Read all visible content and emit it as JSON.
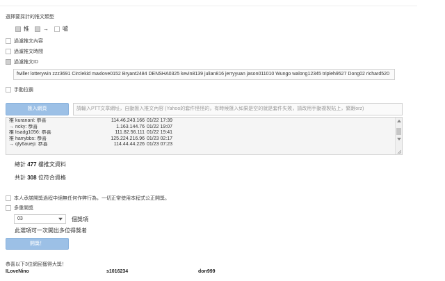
{
  "header": {
    "select_type_label": "選擇要採計的推文類型",
    "push_types": [
      {
        "label": "推",
        "checked": true
      },
      {
        "label": "→",
        "checked": true
      },
      {
        "label": "噓",
        "checked": false
      }
    ]
  },
  "filters": [
    {
      "label": "過濾推文內容",
      "checked": false
    },
    {
      "label": "過濾推文時間",
      "checked": false
    },
    {
      "label": "過濾推文ID",
      "checked": true
    }
  ],
  "id_filter_value": "fwiller lotterywin zzz3691 Circlekid maxlove0152 Bryant2484 DENSHA0325 kevin8139 julian816 jerryyuan jason011010 Wungo walong12345 tripleh9527 Dong02 richard520",
  "manual_pull": {
    "label": "手動拉霸",
    "checked": false
  },
  "import": {
    "button_label": "匯入網頁",
    "url_placeholder": "請輸入PTT文章網址，自動匯入推文內容 (Yahoo的套件怪怪的，有時候匯入如果是空的就是套件失敗，請改用手動複製貼上，緊跟orz)"
  },
  "comments": [
    {
      "name": "推 kurananl: 恭喜",
      "ip": "114.46.243.166",
      "date": "01/22 17:39"
    },
    {
      "name": "→ ncky: 恭喜",
      "ip": "1.163.144.76",
      "date": "01/22 19:07"
    },
    {
      "name": "推 lisadg1056: 恭喜",
      "ip": "111.82.56.111",
      "date": "01/22 19:41"
    },
    {
      "name": "推 harrybbs: 恭喜",
      "ip": "125.224.216.96",
      "date": "01/23 02:17"
    },
    {
      "name": "→ qfy6auep: 恭喜",
      "ip": "114.44.44.226",
      "date": "01/23 07:23"
    }
  ],
  "stats": {
    "total_prefix": "總計",
    "total_count": "477",
    "total_suffix": "樓推文資料",
    "qualified_prefix": "共計",
    "qualified_count": "308",
    "qualified_suffix": "位符合資格"
  },
  "commitment": {
    "label": "本人承諾開獎過程中絕無任何作弊行為，一切正常使用本程式公正開獎。",
    "checked": false
  },
  "multi_draw": {
    "label": "多重開獎",
    "checked": false
  },
  "prize": {
    "selected": "03",
    "suffix": "個獎項",
    "note": "此選項可一次開出多位得獎者"
  },
  "draw_button_label": "開獎！",
  "result": {
    "label": "恭喜以下3位網民獲得大獎！",
    "winners": [
      "ILoveNino",
      "s1016234",
      "don999"
    ]
  },
  "colors": {
    "button": "#9cc0e6",
    "field_border": "#cfcfcf"
  }
}
